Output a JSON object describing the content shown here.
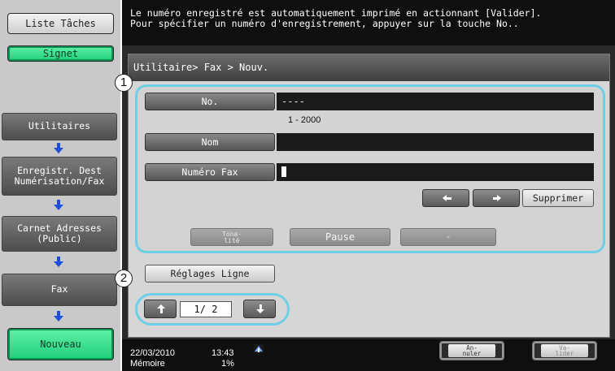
{
  "sidebar": {
    "job_list_label": "Liste Tâches",
    "bookmark_label": "Signet",
    "flow": [
      {
        "label_line1": "Utilitaires",
        "label_line2": ""
      },
      {
        "label_line1": "Enregistr. Dest",
        "label_line2": "Numérisation/Fax"
      },
      {
        "label_line1": "Carnet Adresses",
        "label_line2": "(Public)"
      },
      {
        "label_line1": "Fax",
        "label_line2": ""
      },
      {
        "label_line1": "Nouveau",
        "label_line2": ""
      }
    ]
  },
  "message": {
    "line1": "Le numéro enregistré est automatiquement imprimé en actionnant [Valider].",
    "line2": "Pour spécifier un numéro d'enregistrement, appuyer sur la touche No.."
  },
  "breadcrumb": "Utilitaire> Fax > Nouv.",
  "callouts": {
    "one": "1",
    "two": "2"
  },
  "form": {
    "no_label": "No.",
    "no_value": "----",
    "range": "1 - 2000",
    "name_label": "Nom",
    "name_value": "",
    "fax_label": "Numéro Fax",
    "fax_value": ""
  },
  "keys": {
    "delete_label": "Supprimer",
    "tone_line1": "Tona-",
    "tone_line2": "lité",
    "pause_label": "Pause",
    "dash_label": "-"
  },
  "line_settings_label": "Réglages Ligne",
  "pager": {
    "text": "1/ 2"
  },
  "status": {
    "date": "22/03/2010",
    "time": "13:43",
    "memory_label": "Mémoire",
    "memory_value": "1%"
  },
  "bottom": {
    "cancel_line1": "An-",
    "cancel_line2": "nuler",
    "ok_line1": "Va-",
    "ok_line2": "lider"
  },
  "colors": {
    "accent_green": "#1fcf7a",
    "callout_cyan": "#6fcfe6",
    "flow_arrow_blue": "#1f4fd8"
  }
}
